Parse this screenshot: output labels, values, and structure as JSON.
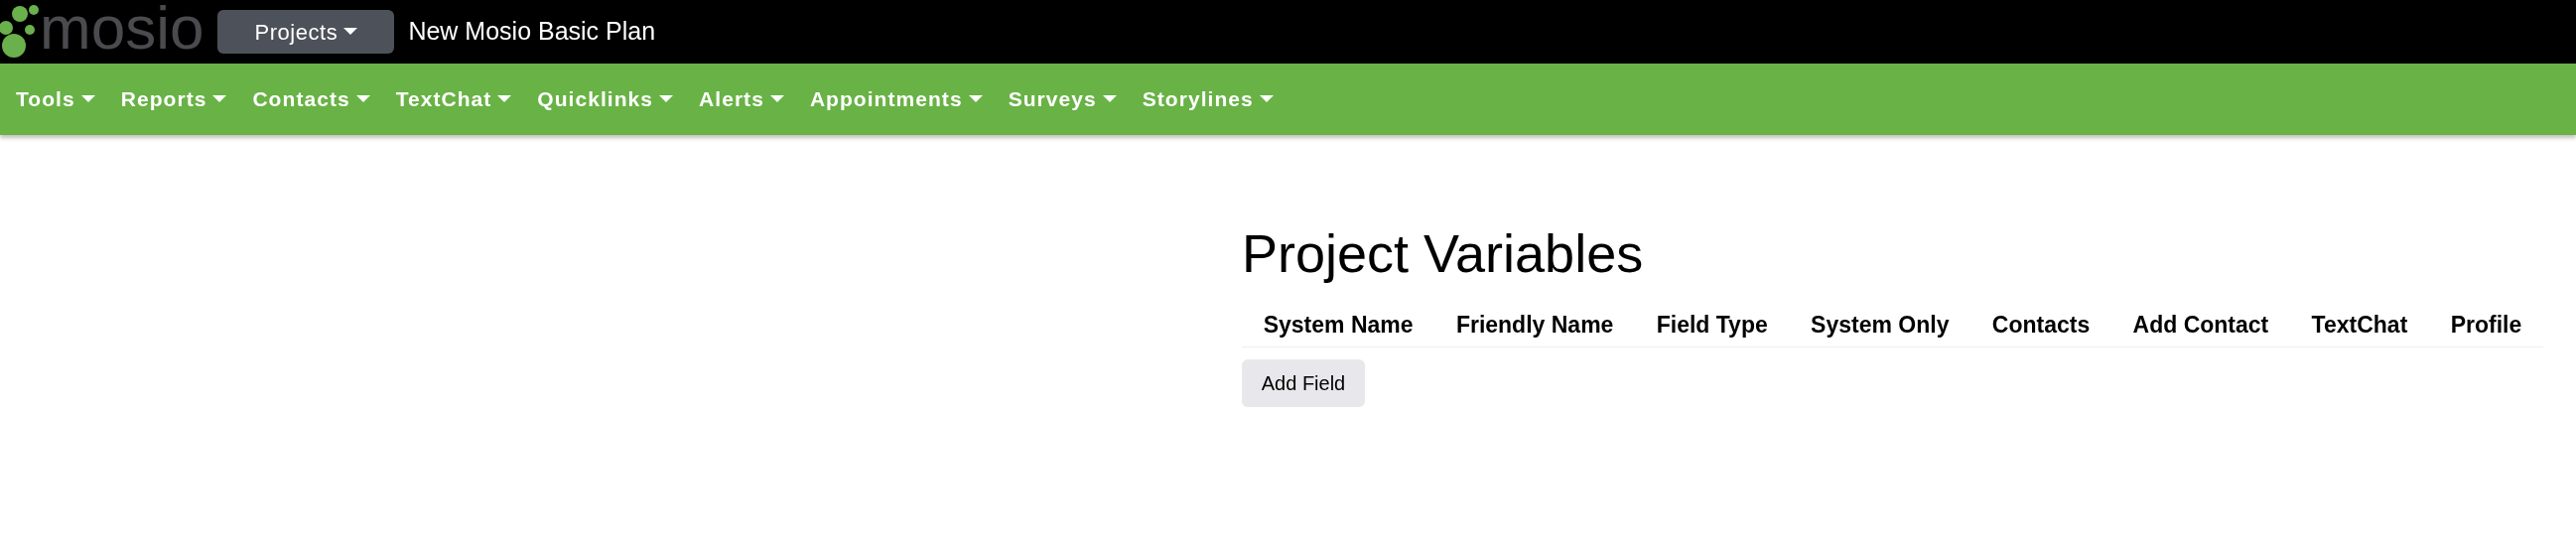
{
  "header": {
    "logo": "mosio",
    "projects_button": "Projects",
    "plan_name": "New Mosio Basic Plan"
  },
  "nav": [
    {
      "label": "Tools"
    },
    {
      "label": "Reports"
    },
    {
      "label": "Contacts"
    },
    {
      "label": "TextChat"
    },
    {
      "label": "Quicklinks"
    },
    {
      "label": "Alerts"
    },
    {
      "label": "Appointments"
    },
    {
      "label": "Surveys"
    },
    {
      "label": "Storylines"
    }
  ],
  "page": {
    "title": "Project Variables",
    "table": {
      "columns": [
        "System Name",
        "Friendly Name",
        "Field Type",
        "System Only",
        "Contacts",
        "Add Contact",
        "TextChat",
        "Profile"
      ]
    },
    "add_button": "Add Field"
  }
}
